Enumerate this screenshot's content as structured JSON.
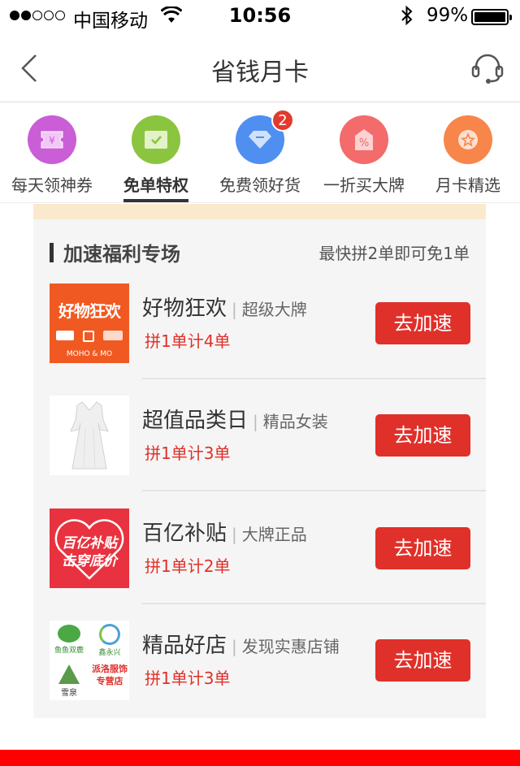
{
  "status_bar": {
    "carrier": "中国移动",
    "time": "10:56",
    "battery": "99%"
  },
  "nav": {
    "title": "省钱月卡",
    "icons": [
      "back-chevron-icon",
      "customer-service-headset-icon"
    ]
  },
  "categories": [
    {
      "label": "每天领神券",
      "icon": "coupon-icon",
      "color": "#c95ed6"
    },
    {
      "label": "免单特权",
      "icon": "checkmark-icon",
      "color": "#8bc53f",
      "active": true
    },
    {
      "label": "免费领好货",
      "icon": "diamond-icon",
      "color": "#4f8ff0",
      "badge": "2"
    },
    {
      "label": "一折买大牌",
      "icon": "percent-tag-icon",
      "color": "#f36b6b"
    },
    {
      "label": "月卡精选",
      "icon": "star-badge-icon",
      "color": "#f8854a"
    }
  ],
  "section": {
    "title": "加速福利专场",
    "note": "最快拼2单即可免1单"
  },
  "items": [
    {
      "name": "好物狂欢",
      "subtitle": "超级大牌",
      "count": "拼1单计4单",
      "button": "去加速",
      "thumb_text": "好物狂欢",
      "thumb_brand": "MOHO & MO"
    },
    {
      "name": "超值品类日",
      "subtitle": "精品女装",
      "count": "拼1单计3单",
      "button": "去加速"
    },
    {
      "name": "百亿补贴",
      "subtitle": "大牌正品",
      "count": "拼1单计2单",
      "button": "去加速",
      "thumb_text_1": "百亿补贴",
      "thumb_text_2": "击穿底价"
    },
    {
      "name": "精品好店",
      "subtitle": "发现实惠店铺",
      "count": "拼1单计3单",
      "button": "去加速",
      "thumb_labels": [
        "鱼鱼双鹿",
        "鑫永兴",
        "雪泉",
        "派洛服饰专营店"
      ]
    }
  ],
  "colors": {
    "accent": "#e0302a",
    "panel_bg": "#f5f5f5",
    "strip": "#fbe9ce"
  }
}
